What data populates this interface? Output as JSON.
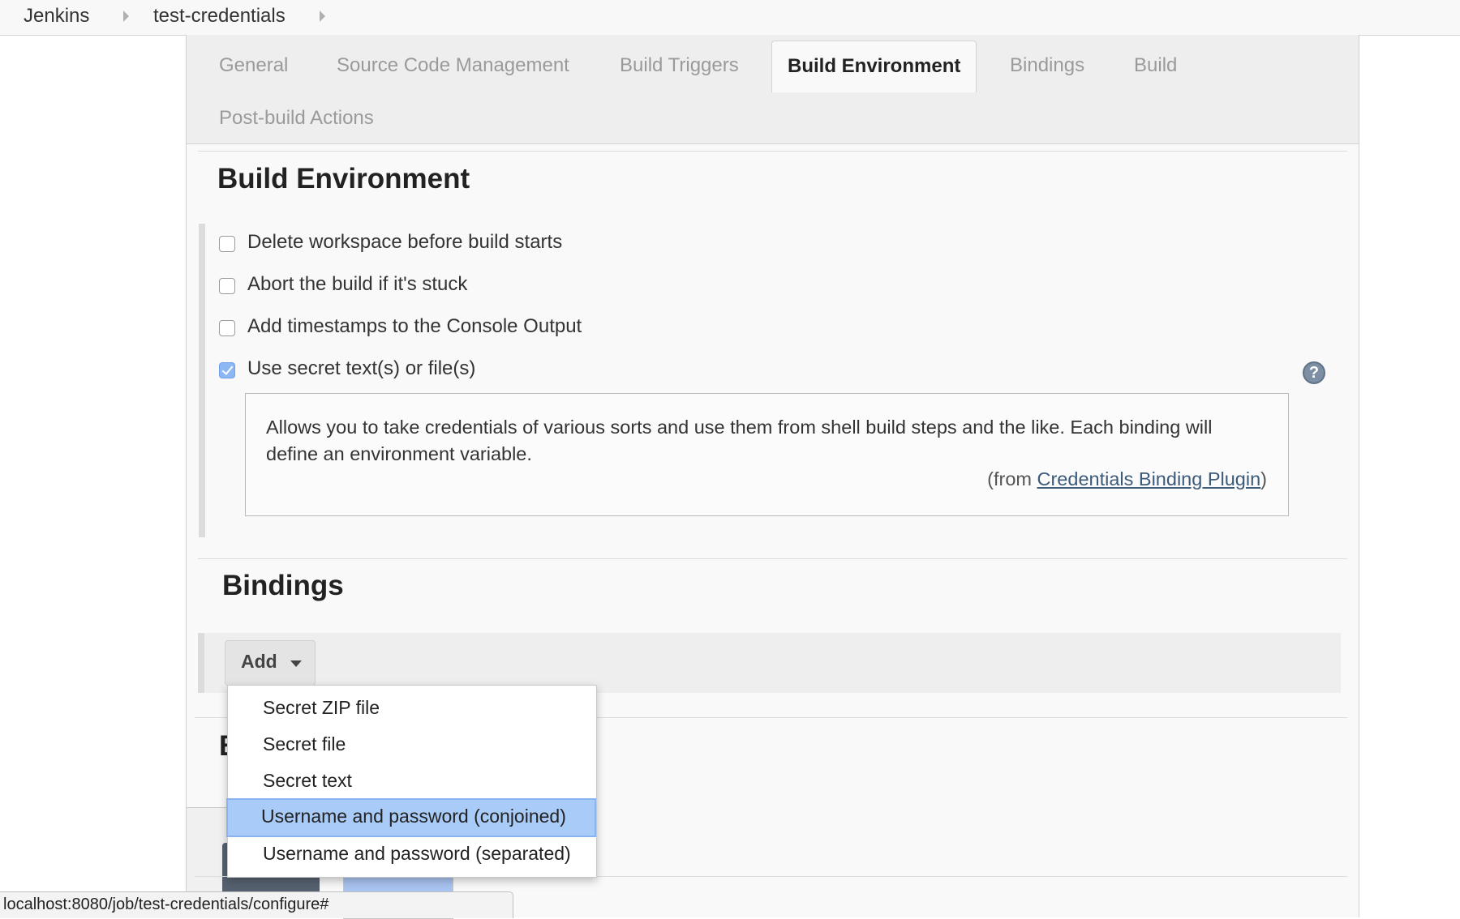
{
  "breadcrumb": {
    "items": [
      "Jenkins",
      "test-credentials"
    ]
  },
  "tabs": [
    {
      "label": "General",
      "active": false
    },
    {
      "label": "Source Code Management",
      "active": false
    },
    {
      "label": "Build Triggers",
      "active": false
    },
    {
      "label": "Build Environment",
      "active": true
    },
    {
      "label": "Bindings",
      "active": false
    },
    {
      "label": "Build",
      "active": false
    },
    {
      "label": "Post-build Actions",
      "active": false
    }
  ],
  "build_environment": {
    "title": "Build Environment",
    "options": [
      {
        "label": "Delete workspace before build starts",
        "checked": false
      },
      {
        "label": "Abort the build if it's stuck",
        "checked": false
      },
      {
        "label": "Add timestamps to the Console Output",
        "checked": false
      },
      {
        "label": "Use secret text(s) or file(s)",
        "checked": true
      }
    ],
    "help": {
      "icon": "question-mark-icon",
      "text": "Allows you to take credentials of various sorts and use them from shell build steps and the like. Each binding will define an environment variable.",
      "from_prefix": "(from ",
      "from_link": "Credentials Binding Plugin",
      "from_suffix": ")"
    }
  },
  "bindings": {
    "title": "Bindings",
    "add_label": "Add",
    "menu_items": [
      {
        "label": "Secret ZIP file",
        "highlighted": false
      },
      {
        "label": "Secret file",
        "highlighted": false
      },
      {
        "label": "Secret text",
        "highlighted": false
      },
      {
        "label": "Username and password (conjoined)",
        "highlighted": true
      },
      {
        "label": "Username and password (separated)",
        "highlighted": false
      }
    ]
  },
  "partial_hidden_title": "B",
  "status_bar": {
    "url": "localhost:8080/job/test-credentials/configure#"
  },
  "colors": {
    "checkbox_checked": "#8bb8f5",
    "menu_highlight": "#a9cbf8",
    "link": "#3c5a7a"
  }
}
